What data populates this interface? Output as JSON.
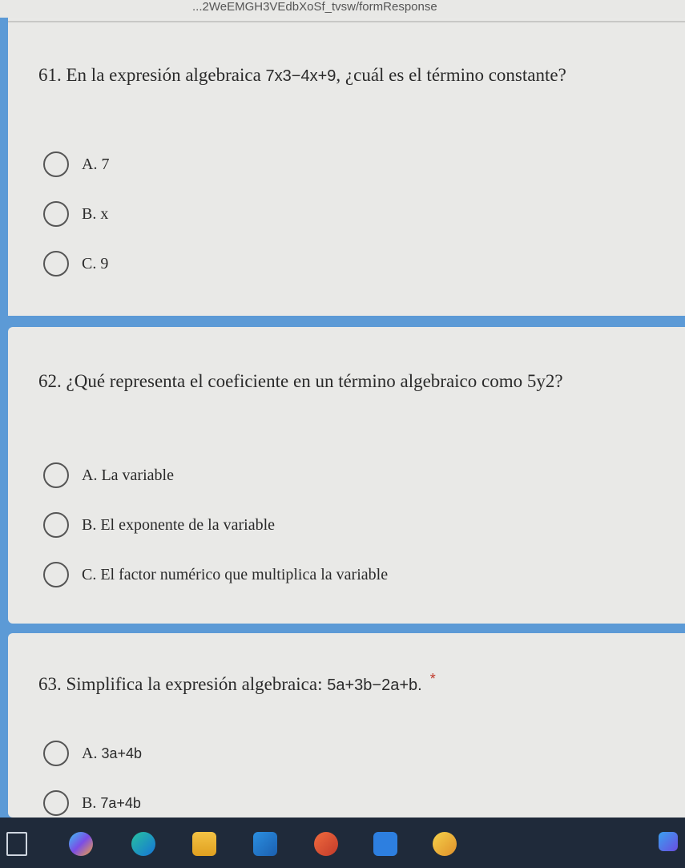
{
  "browser": {
    "url_fragment": "...2WeEMGH3VEdbXoSf_tvsw/formResponse"
  },
  "questions": [
    {
      "number": "61.",
      "text_before": "En la expresión algebraica ",
      "math": "7x3−4x+9",
      "text_after": ", ¿cuál es el término constante?",
      "options": [
        {
          "letter": "A.",
          "text": "7"
        },
        {
          "letter": "B.",
          "text": "x"
        },
        {
          "letter": "C.",
          "text": "9"
        }
      ]
    },
    {
      "number": "62.",
      "text": "¿Qué representa el coeficiente en un término algebraico como 5y2?",
      "options": [
        {
          "letter": "A.",
          "text": "La variable"
        },
        {
          "letter": "B.",
          "text": "El exponente de la variable"
        },
        {
          "letter": "C.",
          "text": "El factor numérico que multiplica la variable"
        }
      ]
    },
    {
      "number": "63.",
      "text_before": "Simplifica la expresión algebraica: ",
      "math": "5a+3b−2a+b.",
      "required_mark": "*",
      "options": [
        {
          "letter": "A.",
          "text": "3a+4b"
        },
        {
          "letter": "B.",
          "text": "7a+4b"
        }
      ]
    }
  ],
  "taskbar": {
    "icons": [
      "task-view-icon",
      "copilot-icon",
      "edge-icon",
      "file-explorer-icon",
      "store-icon",
      "office-icon",
      "app-l-icon",
      "game-icon",
      "media-player-icon"
    ]
  }
}
